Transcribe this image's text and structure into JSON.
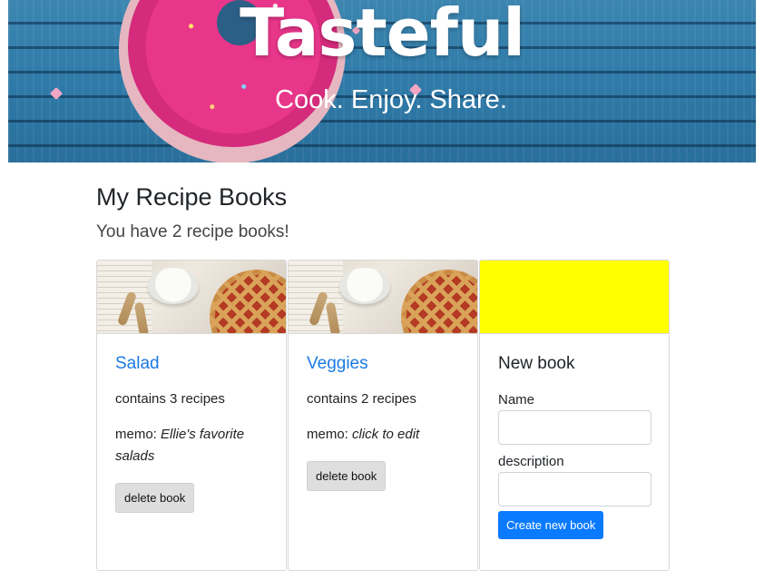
{
  "hero": {
    "title": "Tasteful",
    "subtitle": "Cook. Enjoy. Share."
  },
  "page": {
    "title": "My Recipe Books",
    "lead": "You have 2 recipe books!"
  },
  "books": [
    {
      "name": "Salad",
      "count_text": "contains 3 recipes",
      "memo_label": "memo: ",
      "memo_value": "Ellie's favorite salads",
      "delete_label": "delete book"
    },
    {
      "name": "Veggies",
      "count_text": "contains 2 recipes",
      "memo_label": "memo: ",
      "memo_value": "click to edit",
      "delete_label": "delete book"
    }
  ],
  "new_book": {
    "title": "New book",
    "name_label": "Name",
    "name_value": "",
    "description_label": "description",
    "description_value": "",
    "submit_label": "Create new book",
    "placeholder_color": "#ffff00"
  },
  "colors": {
    "link": "#1a7ae3",
    "primary": "#0a7bff",
    "secondary_button": "#dedede"
  }
}
